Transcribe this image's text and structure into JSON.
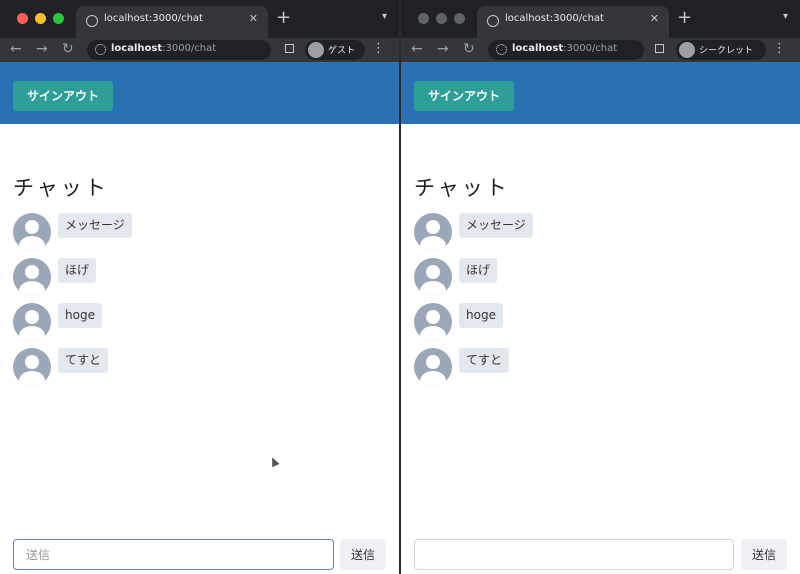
{
  "windows": [
    {
      "id": "left",
      "tab_title": "localhost:3000/chat",
      "url_host": "localhost",
      "url_rest": ":3000/chat",
      "profile_label": "ゲスト",
      "signout_label": "サインアウト",
      "chat_title": "チャット",
      "messages": [
        "メッセージ",
        "ほげ",
        "hoge",
        "てすと"
      ],
      "input_value": "",
      "input_placeholder": "送信",
      "send_label": "送信",
      "focused": true
    },
    {
      "id": "right",
      "tab_title": "localhost:3000/chat",
      "url_host": "localhost",
      "url_rest": ":3000/chat",
      "profile_label": "シークレット",
      "signout_label": "サインアウト",
      "chat_title": "チャット",
      "messages": [
        "メッセージ",
        "ほげ",
        "hoge",
        "てすと"
      ],
      "input_value": "",
      "input_placeholder": "",
      "send_label": "送信",
      "focused": false
    }
  ],
  "icons": {
    "back": "arrow-left-icon",
    "forward": "arrow-right-icon",
    "reload": "reload-icon",
    "site_info": "site-info-icon",
    "new_tab": "plus-icon",
    "menu": "kebab-menu-icon",
    "avatar": "user-avatar-icon",
    "cursor": "mouse-cursor-icon"
  },
  "colors": {
    "header": "#2a71b4",
    "signout_button": "#2d9f97",
    "bubble": "#e3e8ef",
    "avatar": "#9aa7b8",
    "browser_frame": "#202124"
  }
}
